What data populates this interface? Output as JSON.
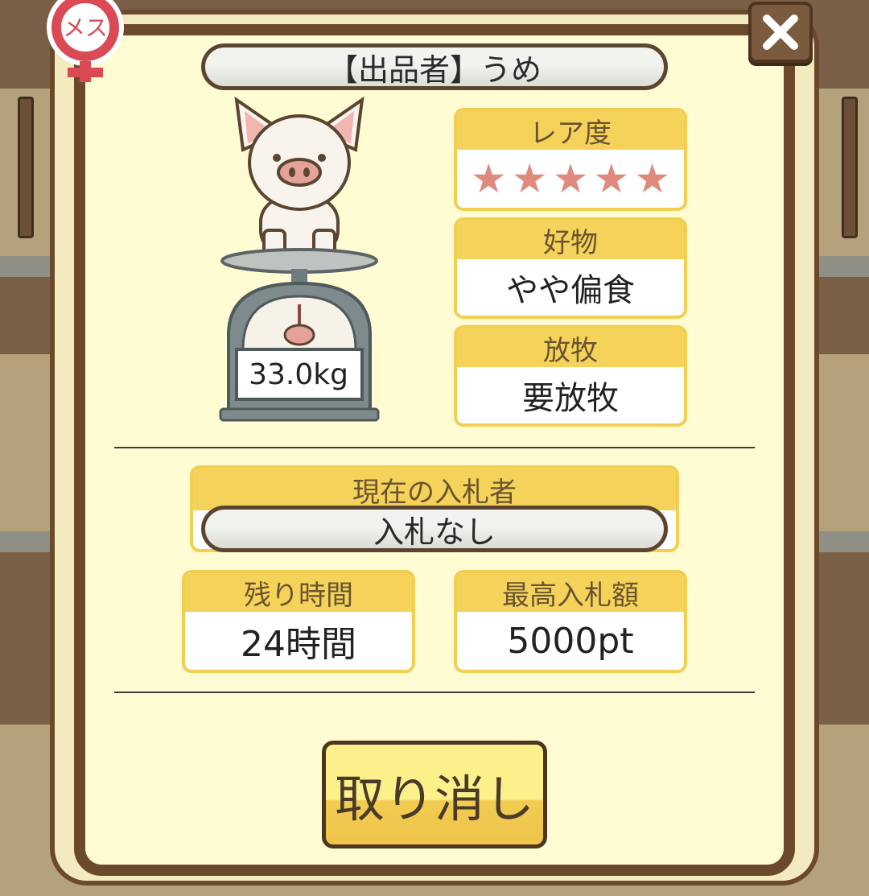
{
  "seller": {
    "label": "【出品者】うめ"
  },
  "badge": {
    "gender_text": "メス"
  },
  "pig": {
    "weight": "33.0kg"
  },
  "rarity": {
    "title": "レア度",
    "stars": 5
  },
  "likes": {
    "title": "好物",
    "value": "やや偏食"
  },
  "grazing": {
    "title": "放牧",
    "value": "要放牧"
  },
  "bidder": {
    "title": "現在の入札者",
    "value": "入札なし"
  },
  "time_left": {
    "title": "残り時間",
    "value": "24時間"
  },
  "max_bid": {
    "title": "最高入札額",
    "value": "5000pt"
  },
  "actions": {
    "cancel_label": "取り消し"
  },
  "colors": {
    "header": "#f5d35a",
    "frame": "#6b4a2b",
    "panel": "#fffbd2",
    "star": "#e08a7e",
    "badge": "#d94a55"
  }
}
